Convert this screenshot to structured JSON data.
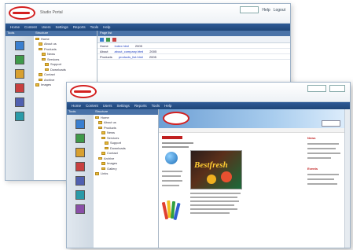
{
  "back_window": {
    "brand": "Studio Portal",
    "top_links": [
      "Help",
      "Logout"
    ],
    "menu": [
      "Home",
      "Content",
      "Users",
      "Settings",
      "Reports",
      "Tools",
      "Help"
    ],
    "icon_panel_header": "Tools",
    "tree_header": "Structure",
    "tree": [
      "Home",
      "About us",
      "Products",
      "News",
      "Services",
      "Support",
      "Downloads",
      "Contact",
      "Archive",
      "Images"
    ],
    "content_header": "Page list",
    "rows": [
      {
        "name": "Home",
        "link": "index.html",
        "date": "2005"
      },
      {
        "name": "About",
        "link": "about_company.html",
        "date": "2005"
      },
      {
        "name": "Products",
        "link": "products_list.html",
        "date": "2005"
      }
    ]
  },
  "front_window": {
    "menu": [
      "Home",
      "Content",
      "Users",
      "Settings",
      "Reports",
      "Tools",
      "Help"
    ],
    "icon_panel_header": "Tools",
    "tree_header": "Structure",
    "tree": [
      "Home",
      "About us",
      "Products",
      "News",
      "Services",
      "Support",
      "Downloads",
      "Contact",
      "Archive",
      "Images",
      "Gallery",
      "Links"
    ],
    "site": {
      "product_name": "Bestfresh",
      "side_heading": "News",
      "side_heading2": "Events"
    }
  }
}
